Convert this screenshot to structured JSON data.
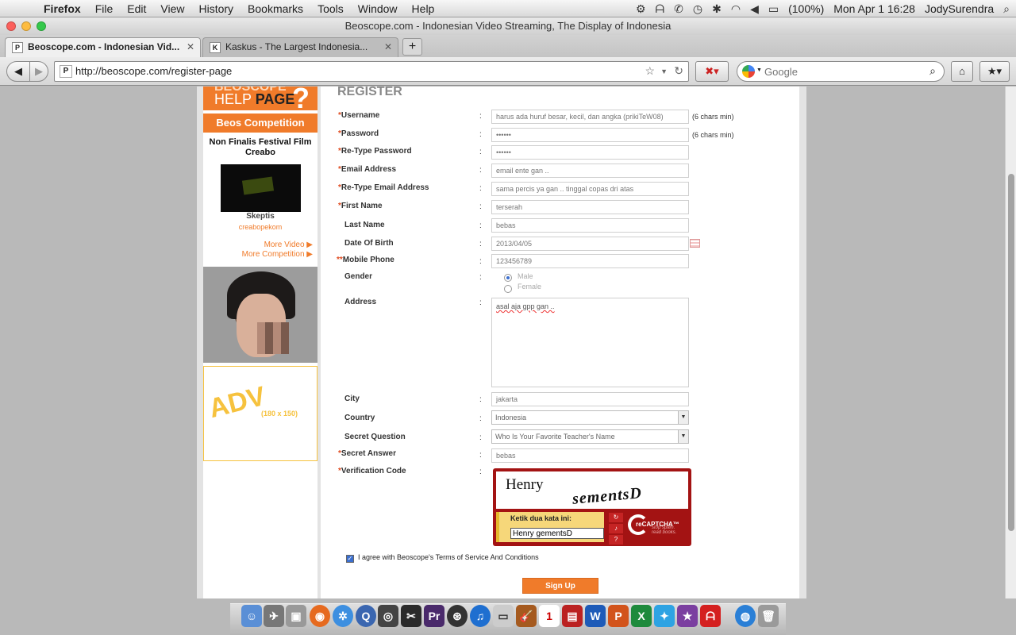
{
  "menubar": {
    "app": "Firefox",
    "items": [
      "File",
      "Edit",
      "View",
      "History",
      "Bookmarks",
      "Tools",
      "Window",
      "Help"
    ],
    "battery": "(100%)",
    "datetime": "Mon Apr 1  16:28",
    "user": "JodySurendra"
  },
  "window": {
    "title": "Beoscope.com - Indonesian Video Streaming, The Display of Indonesia"
  },
  "tabs": [
    {
      "label": "Beoscope.com - Indonesian Vid...",
      "favicon": "P"
    },
    {
      "label": "Kaskus - The Largest Indonesia...",
      "favicon": "K"
    }
  ],
  "navbar": {
    "url": "http://beoscope.com/register-page",
    "search_placeholder": "Google"
  },
  "sidebar": {
    "help_line1": "BEOSCOPE",
    "help_line2": "HELP",
    "help_line3": "PAGE",
    "competition_header": "Beos Competition",
    "competition_title": "Non Finalis Festival Film Creabo",
    "video_name": "Skeptis",
    "video_user": "creabopekom",
    "more_video": "More Video ▶",
    "more_competition": "More Competition ▶",
    "adv_text": "ADV",
    "adv_size": "(180 x 150)"
  },
  "form": {
    "heading": "REGISTER",
    "fields": {
      "username": {
        "label": "Username",
        "value": "harus ada huruf besar, kecil, dan angka (prikiTeW08)",
        "hint": "(6 chars min)"
      },
      "password": {
        "label": "Password",
        "value": "••••••",
        "hint": "(6 chars min)"
      },
      "retype_password": {
        "label": "Re-Type Password",
        "value": "••••••"
      },
      "email": {
        "label": "Email Address",
        "value": "email ente gan .."
      },
      "retype_email": {
        "label": "Re-Type Email Address",
        "value": "sama percis ya gan .. tinggal copas dri atas"
      },
      "first_name": {
        "label": "First Name",
        "value": "terserah"
      },
      "last_name": {
        "label": "Last Name",
        "value": "bebas"
      },
      "dob": {
        "label": "Date Of Birth",
        "value": "2013/04/05"
      },
      "mobile": {
        "label": "Mobile Phone",
        "value": "123456789"
      },
      "gender": {
        "label": "Gender",
        "option_male": "Male",
        "option_female": "Female",
        "selected": "Male"
      },
      "address": {
        "label": "Address",
        "value": "asal aja gpp gan .."
      },
      "city": {
        "label": "City",
        "value": "jakarta"
      },
      "country": {
        "label": "Country",
        "value": "Indonesia"
      },
      "secret_question": {
        "label": "Secret Question",
        "value": "Who Is Your Favorite Teacher's Name"
      },
      "secret_answer": {
        "label": "Secret Answer",
        "value": "bebas"
      },
      "verification": {
        "label": "Verification Code"
      }
    },
    "captcha": {
      "word1": "Henry",
      "word2": "sementsD",
      "prompt": "Ketik dua kata ini:",
      "input_value": "Henry gementsD",
      "brand": "reCAPTCHA™",
      "tagline1": "stop spam.",
      "tagline2": "read books."
    },
    "agree_text": "I agree with Beoscope's Terms of Service And Conditions",
    "agree_checked": true,
    "submit": "Sign Up"
  },
  "colors": {
    "accent": "#f07b2a",
    "required": "#e04a1f",
    "captcha": "#a31313",
    "adv": "#f6c23e"
  }
}
